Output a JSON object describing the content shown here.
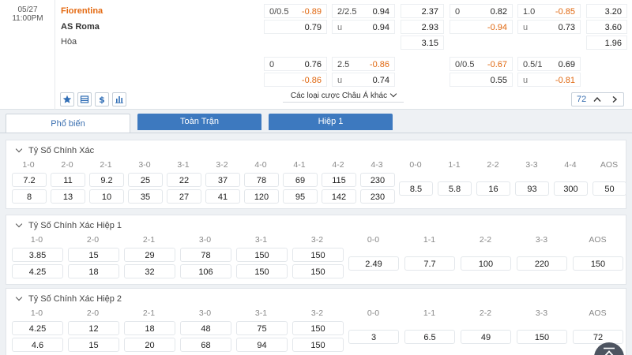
{
  "match": {
    "date": "05/27",
    "time": "11:00PM",
    "home": "Fiorentina",
    "away": "AS Roma",
    "draw": "Hòa"
  },
  "odds_row1": {
    "hdp_ft": {
      "line": "0/0.5",
      "home": "-0.89",
      "away": "0.79"
    },
    "ou_ft": {
      "line": "2/2.5",
      "over": "0.94",
      "u_label": "u",
      "under": "0.94"
    },
    "x12_ft": {
      "home": "2.37",
      "away": "2.93",
      "draw": "3.15"
    },
    "hdp_h1": {
      "line": "0",
      "home": "0.82",
      "away": "-0.94"
    },
    "ou_h1": {
      "line": "1.0",
      "over": "-0.85",
      "u_label": "u",
      "under": "0.73"
    },
    "x12_h1": {
      "home": "3.20",
      "away": "3.60",
      "draw": "1.96"
    }
  },
  "odds_row2": {
    "hdp_ft": {
      "line": "0",
      "home": "0.76",
      "away": "-0.86"
    },
    "ou_ft": {
      "line": "2.5",
      "over": "-0.86",
      "u_label": "u",
      "under": "0.74"
    },
    "hdp_h1": {
      "line": "0/0.5",
      "home": "-0.67",
      "away": "0.55"
    },
    "ou_h1": {
      "line": "0.5/1",
      "over": "0.69",
      "u_label": "u",
      "under": "-0.81"
    }
  },
  "footer": {
    "other_bets": "Các loại cược Châu Á khác",
    "count": "72"
  },
  "icons": [
    "star-icon",
    "list-icon",
    "dollar-icon",
    "chart-icon",
    "chevron-up-icon",
    "chevron-right-icon",
    "arrow-up-icon"
  ],
  "tabs": [
    "Phổ biến",
    "Toàn Trận",
    "Hiệp 1"
  ],
  "sections": [
    {
      "title": "Tỷ Số Chính Xác",
      "headers": [
        "1-0",
        "2-0",
        "2-1",
        "3-0",
        "3-1",
        "3-2",
        "4-0",
        "4-1",
        "4-2",
        "4-3",
        "0-0",
        "1-1",
        "2-2",
        "3-3",
        "4-4",
        "AOS"
      ],
      "home": [
        "7.2",
        "11",
        "9.2",
        "25",
        "22",
        "37",
        "78",
        "69",
        "115",
        "230"
      ],
      "away": [
        "8",
        "13",
        "10",
        "35",
        "27",
        "41",
        "120",
        "95",
        "142",
        "230"
      ],
      "draws": [
        "8.5",
        "5.8",
        "16",
        "93",
        "300",
        "50"
      ]
    },
    {
      "title": "Tỷ Số Chính Xác Hiệp 1",
      "headers": [
        "1-0",
        "2-0",
        "2-1",
        "3-0",
        "3-1",
        "3-2",
        "0-0",
        "1-1",
        "2-2",
        "3-3",
        "AOS"
      ],
      "home": [
        "3.85",
        "15",
        "29",
        "78",
        "150",
        "150"
      ],
      "away": [
        "4.25",
        "18",
        "32",
        "106",
        "150",
        "150"
      ],
      "draws": [
        "2.49",
        "7.7",
        "100",
        "220",
        "150"
      ]
    },
    {
      "title": "Tỷ Số Chính Xác Hiệp 2",
      "headers": [
        "1-0",
        "2-0",
        "2-1",
        "3-0",
        "3-1",
        "3-2",
        "0-0",
        "1-1",
        "2-2",
        "3-3",
        "AOS"
      ],
      "home": [
        "4.25",
        "12",
        "18",
        "48",
        "75",
        "150"
      ],
      "away": [
        "4.6",
        "15",
        "20",
        "68",
        "94",
        "150"
      ],
      "draws": [
        "3",
        "6.5",
        "49",
        "150",
        "72"
      ]
    }
  ],
  "colors": {
    "accent": "#3d79bf",
    "home_team": "#e46a12",
    "negative": "#e0670f"
  }
}
